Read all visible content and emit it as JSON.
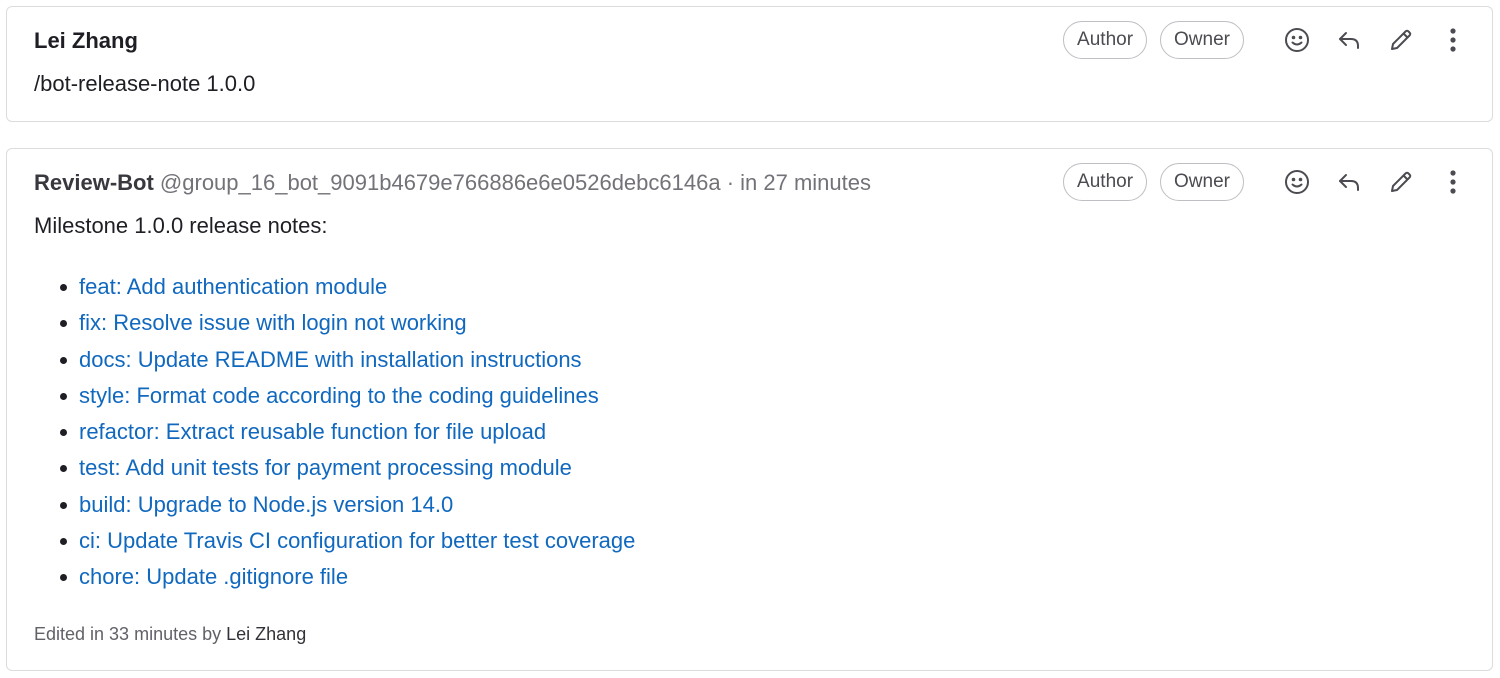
{
  "notes": [
    {
      "author": "Lei Zhang",
      "body": "/bot-release-note 1.0.0",
      "badges": [
        "Author",
        "Owner"
      ],
      "action_icons": [
        "smile-icon",
        "reply-icon",
        "pencil-icon",
        "more-vertical-icon"
      ]
    },
    {
      "author": "Review-Bot",
      "handle": "@group_16_bot_9091b4679e766886e6e0526debc6146a",
      "time_text": "· in 27 minutes",
      "badges": [
        "Author",
        "Owner"
      ],
      "intro": "Milestone 1.0.0 release notes:",
      "release_items": [
        "feat: Add authentication module",
        "fix: Resolve issue with login not working",
        "docs: Update README with installation instructions",
        "style: Format code according to the coding guidelines",
        "refactor: Extract reusable function for file upload",
        "test: Add unit tests for payment processing module",
        "build: Upgrade to Node.js version 14.0",
        "ci: Update Travis CI configuration for better test coverage",
        "chore: Update .gitignore file"
      ],
      "edited_prefix": "Edited in 33 minutes by",
      "edited_by": "Lei Zhang"
    }
  ],
  "colors": {
    "link": "#1068bf",
    "border": "#dcdcde",
    "muted_text": "#737278"
  }
}
